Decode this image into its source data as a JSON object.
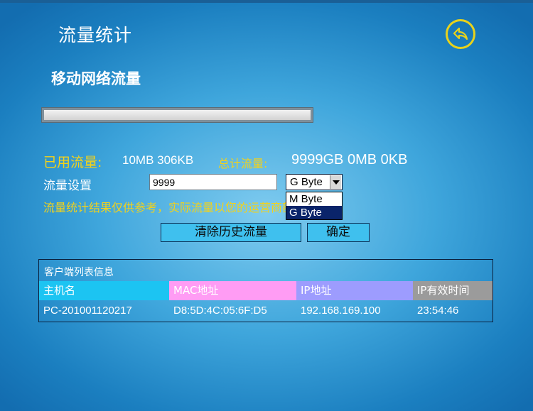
{
  "header": {
    "title": "流量统计",
    "back_icon": "back-arrow-icon"
  },
  "section": {
    "subtitle": "移动网络流量"
  },
  "usage": {
    "used_label": "已用流量:",
    "used_value": "10MB 306KB",
    "total_label": "总计流量:",
    "total_value": "9999GB 0MB 0KB",
    "progress_fraction": 0.0
  },
  "setting": {
    "label": "流量设置",
    "input_value": "9999",
    "unit_selected": "G Byte",
    "unit_options": [
      "M Byte",
      "G Byte"
    ]
  },
  "note": "流量统计结果仅供参考，实际流量以您的运营商额度为准。",
  "buttons": {
    "clear": "清除历史流量",
    "ok": "确定"
  },
  "clients": {
    "title": "客户端列表信息",
    "columns": [
      "主机名",
      "MAC地址",
      "IP地址",
      "IP有效时间"
    ],
    "column_colors": [
      "#1cc4f2",
      "#ff9cf4",
      "#9d9cfe",
      "#9b9b9b"
    ],
    "rows": [
      [
        "PC-201001120217",
        "D8:5D:4C:05:6F:D5",
        "192.168.169.100",
        "23:54:46"
      ]
    ]
  },
  "colors": {
    "accent_yellow": "#f3d21a",
    "button_cyan": "#3fc0ee",
    "selected_option": "#0a246a"
  }
}
